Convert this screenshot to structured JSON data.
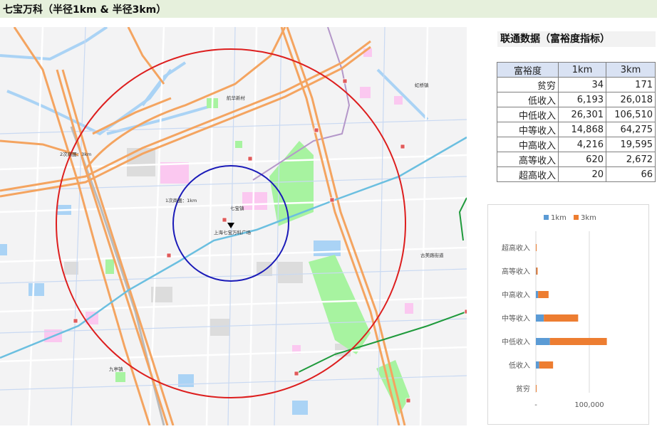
{
  "page_title": "七宝万科（半径1km & 半径3km）",
  "map": {
    "labels": {
      "circle_3km": "2次商圏：3km",
      "circle_1km": "1次商圏：1km",
      "qibao_town": "七宝镇",
      "marker": "上海七宝万科广场",
      "hangkou": "航华新村",
      "hongqiao": "虹桥镇",
      "gumei": "古美路街道",
      "jiuting": "九亭镇"
    },
    "colors": {
      "circle_3km": "#dd1e1e",
      "circle_1km": "#1a1ab8",
      "highway": "#f4a460",
      "metro_blue": "#6bbfe0",
      "metro_green": "#1f9a3c",
      "park": "#a7f3a0"
    }
  },
  "panel": {
    "title": "联通数据（富裕度指标）",
    "table": {
      "headers": [
        "富裕度",
        "1km",
        "3km"
      ],
      "rows": [
        [
          "贫穷",
          "34",
          "171"
        ],
        [
          "低收入",
          "6,193",
          "26,018"
        ],
        [
          "中低收入",
          "26,301",
          "106,510"
        ],
        [
          "中等收入",
          "14,868",
          "64,275"
        ],
        [
          "中高收入",
          "4,216",
          "19,595"
        ],
        [
          "高等收入",
          "620",
          "2,672"
        ],
        [
          "超高收入",
          "20",
          "66"
        ]
      ]
    }
  },
  "chart_data": {
    "type": "bar",
    "orientation": "horizontal",
    "stacked": true,
    "categories": [
      "超高收入",
      "高等收入",
      "中高收入",
      "中等收入",
      "中低收入",
      "低收入",
      "贫穷"
    ],
    "series": [
      {
        "name": "1km",
        "color": "#5b9bd5",
        "values": [
          20,
          620,
          4216,
          14868,
          26301,
          6193,
          34
        ]
      },
      {
        "name": "3km",
        "color": "#ed7d31",
        "values": [
          66,
          2672,
          19595,
          64275,
          106510,
          26018,
          171
        ]
      }
    ],
    "xlim": [
      0,
      200000
    ],
    "xtick_labels": [
      "-",
      "100,000"
    ],
    "legend_position": "top",
    "grid": true
  }
}
